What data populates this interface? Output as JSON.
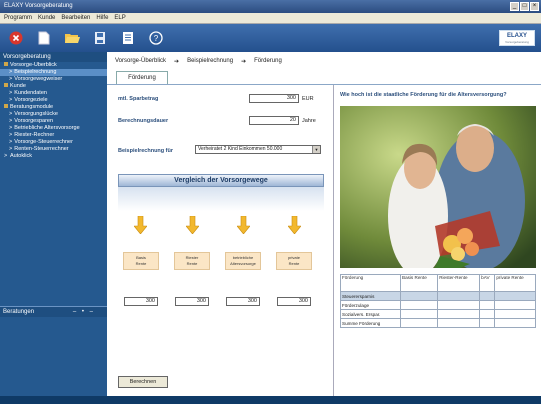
{
  "window": {
    "title": "ELAXY Vorsorgeberatung"
  },
  "menu": [
    "Programm",
    "Kunde",
    "Bearbeiten",
    "Hilfe",
    "ELP"
  ],
  "toolbar": {
    "icons": [
      "close-icon",
      "new-document-icon",
      "open-folder-icon",
      "save-icon",
      "print-icon",
      "help-icon"
    ]
  },
  "logo": {
    "text": "ELAXY",
    "sub": "Vorsorgeberatung"
  },
  "sidebar": {
    "title": "Vorsorgeberatung",
    "items": [
      {
        "label": "Vorsorge-Überblick",
        "level": 0
      },
      {
        "label": "Beispielrechnung",
        "level": 1,
        "active": true
      },
      {
        "label": "Vorsorgewegweiser",
        "level": 1
      },
      {
        "label": "Kunde",
        "level": 0
      },
      {
        "label": "Kundendaten",
        "level": 1
      },
      {
        "label": "Vorsorgeziele",
        "level": 1
      },
      {
        "label": "Beratungsmodule",
        "level": 0
      },
      {
        "label": "Versorgungslücke",
        "level": 1
      },
      {
        "label": "Vorsorgesparen",
        "level": 1
      },
      {
        "label": "Betriebliche Altersvorsorge",
        "level": 1
      },
      {
        "label": "Riester-Rechner",
        "level": 1
      },
      {
        "label": "Vorsorge-Steuerrechner",
        "level": 1
      },
      {
        "label": "Renten-Steuerrechner",
        "level": 1
      },
      {
        "label": "Autoklick",
        "level": 0
      }
    ],
    "footer": "Beratungen",
    "footer_controls": "– • –"
  },
  "breadcrumb": {
    "step1": "Vorsorge-Überblick",
    "step2": "Beispielrechnung",
    "step3": "Förderung",
    "sep": "➔"
  },
  "tab": {
    "label": "Förderung"
  },
  "form": {
    "savings_label": "mtl. Sparbetrag",
    "savings_value": "300",
    "savings_unit": "EUR",
    "duration_label": "Berechnungsdauer",
    "duration_value": "20",
    "duration_unit": "Jahre",
    "example_label": "Beispielrechnung für",
    "example_value": "Verheiratet 2 Kind Einkommen 50.000"
  },
  "comparison": {
    "title": "Vergleich der Vorsorgewege",
    "options": [
      {
        "line1": "Basis",
        "line2": "Rente",
        "amount": "300"
      },
      {
        "line1": "Riester",
        "line2": "Rente",
        "amount": "300"
      },
      {
        "line1": "betriebliche",
        "line2": "Altersvorsorge",
        "amount": "300"
      },
      {
        "line1": "private",
        "line2": "Rente",
        "amount": "300"
      }
    ]
  },
  "buttons": {
    "calculate": "Berechnen"
  },
  "right": {
    "question": "Wie hoch ist die staatliche Förderung für die Altersversorgung?"
  },
  "table": {
    "headers": [
      "Förderung",
      "Basis Rente",
      "Riester-Rente",
      "bAV",
      "private Rente"
    ],
    "rows": [
      [
        "Steuerersparnis",
        "",
        "",
        "",
        ""
      ],
      [
        "Förderzulage",
        "",
        "",
        "",
        ""
      ],
      [
        "Sozialvers. Erspar.",
        "",
        "",
        "",
        ""
      ],
      [
        "Summe Förderung",
        "",
        "",
        "",
        ""
      ]
    ]
  },
  "colors": {
    "sidebar": "#25598f",
    "toolbar": "#3f6fae",
    "option_box": "#fbe6c6",
    "arrow": "#f2b82e",
    "banner": "#9fb7d6"
  }
}
